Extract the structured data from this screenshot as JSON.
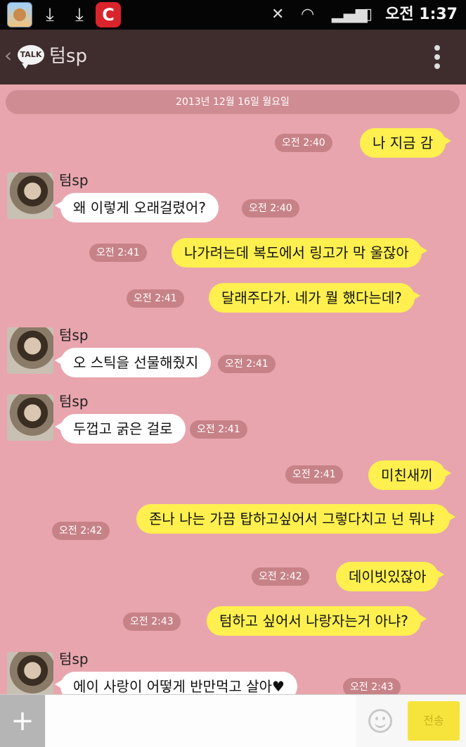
{
  "status_bar": {
    "time": "오전 1:37",
    "icons": [
      "hamster-app-icon",
      "download-icon",
      "download-icon",
      "red-app-icon",
      "no-signal-icon",
      "wifi-icon",
      "signal-icon",
      "battery-icon"
    ]
  },
  "header": {
    "logo_text": "TALK",
    "title": "텀sp"
  },
  "date_separator": "2013년 12월 16일 월요일",
  "messages": [
    {
      "from": "me",
      "text": "나 지금 감",
      "time": "오전 2:40"
    },
    {
      "from": "them",
      "sender": "텀sp",
      "text": "왜 이렇게 오래걸렸어?",
      "time": "오전 2:40"
    },
    {
      "from": "me",
      "text": "나가려는데 복도에서 링고가 막 울잖아",
      "time": "오전 2:41"
    },
    {
      "from": "me",
      "text": "달래주다가. 네가 뭘 했다는데?",
      "time": "오전 2:41"
    },
    {
      "from": "them",
      "sender": "텀sp",
      "text": "오 스틱을 선물해줬지",
      "time": "오전 2:41"
    },
    {
      "from": "them",
      "sender": "텀sp",
      "text": "두껍고 굵은 걸로",
      "time": "오전 2:41"
    },
    {
      "from": "me",
      "text": "미친새끼",
      "time": "오전 2:41"
    },
    {
      "from": "me",
      "text": "존나 나는 가끔 탑하고싶어서 그렇다치고 넌 뭐냐",
      "time": "오전 2:42"
    },
    {
      "from": "me",
      "text": "데이빗있잖아",
      "time": "오전 2:42"
    },
    {
      "from": "me",
      "text": "텀하고 싶어서 나랑자는거 아냐?",
      "time": "오전 2:43"
    },
    {
      "from": "them",
      "sender": "텀sp",
      "text": "에이 사랑이 어떻게 반만먹고 살아♥",
      "time": "오전 2:43"
    }
  ],
  "input_bar": {
    "plus_label": "+",
    "placeholder": "",
    "send_label": "전송"
  },
  "colors": {
    "chat_background": "#e8a5ad",
    "my_bubble": "#fff04f",
    "their_bubble": "#ffffff",
    "title_bar": "#3f2c2c"
  }
}
